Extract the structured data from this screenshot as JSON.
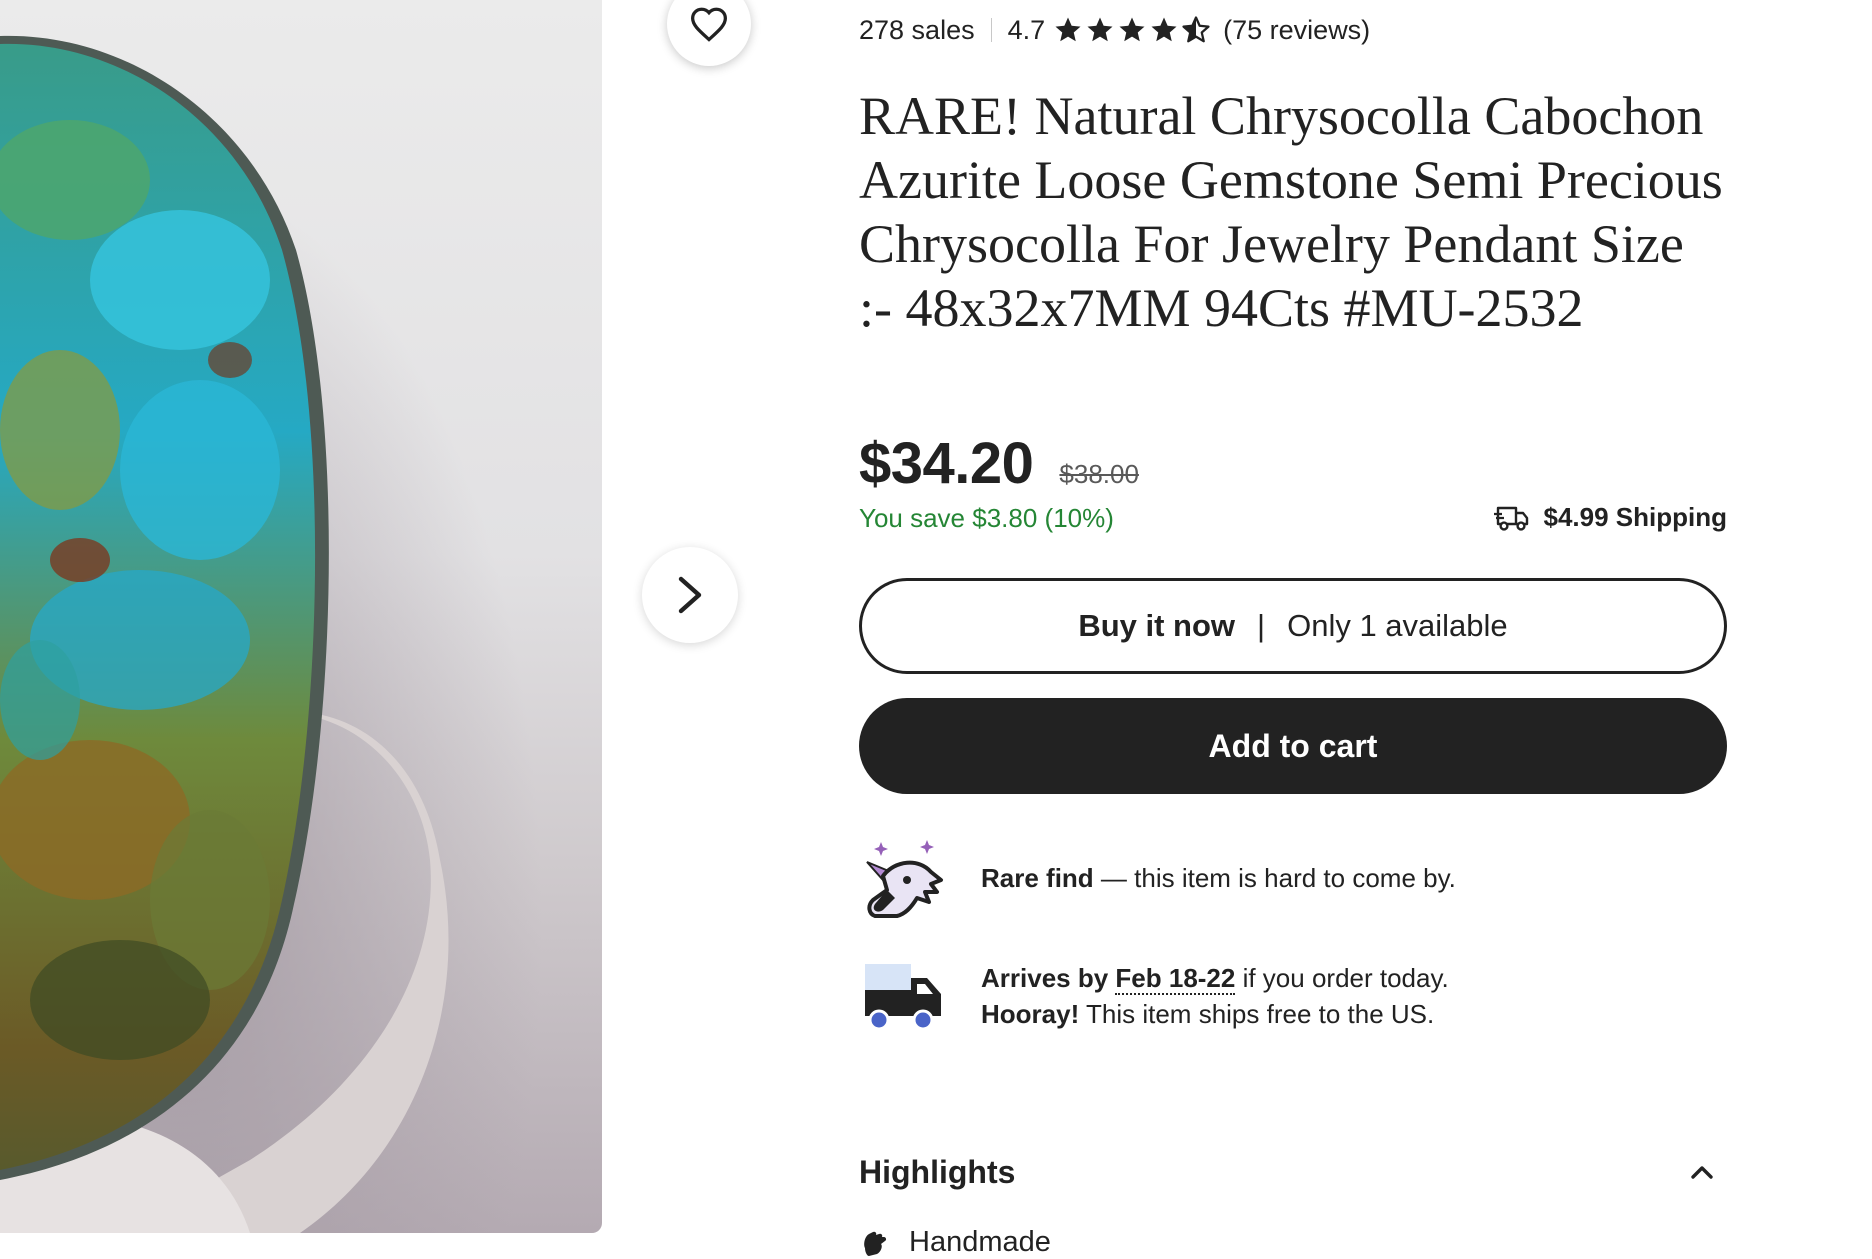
{
  "listing": {
    "sales": "278 sales",
    "rating": "4.7",
    "reviews": "(75 reviews)",
    "stars_filled": 4.5,
    "title": "RARE! Natural Chrysocolla Cabochon Azurite Loose Gemstone Semi Precious Chrysocolla For Jewelry Pendant Size :- 48x32x7MM 94Cts #MU-2532"
  },
  "pricing": {
    "price": "$34.20",
    "original_price": "$38.00",
    "savings": "You save $3.80 (10%)",
    "shipping": "$4.99 Shipping"
  },
  "buttons": {
    "buy_now": "Buy it now",
    "buy_separator": "|",
    "availability": "Only 1 available",
    "add_to_cart": "Add to cart"
  },
  "perks": {
    "rare_bold": "Rare find",
    "rare_text": " — this item is hard to come by.",
    "arrives_prefix": "Arrives by ",
    "arrives_dates": "Feb 18-22",
    "arrives_suffix": " if you order today.",
    "hooray_bold": "Hooray!",
    "hooray_text": " This item ships free to the US."
  },
  "highlights": {
    "heading": "Highlights",
    "first_item": "Handmade"
  },
  "icons": {
    "favorite": "heart-icon",
    "next": "chevron-right-icon",
    "star": "star-icon",
    "shipping": "delivery-truck-icon",
    "rare": "unicorn-icon",
    "arrival": "truck-icon",
    "collapse": "chevron-up-icon",
    "handmade": "hand-icon"
  },
  "colors": {
    "savings_green": "#258635",
    "button_dark": "#222222",
    "rare_purple": "#9560b8",
    "truck_blue": "#4a64c8"
  }
}
